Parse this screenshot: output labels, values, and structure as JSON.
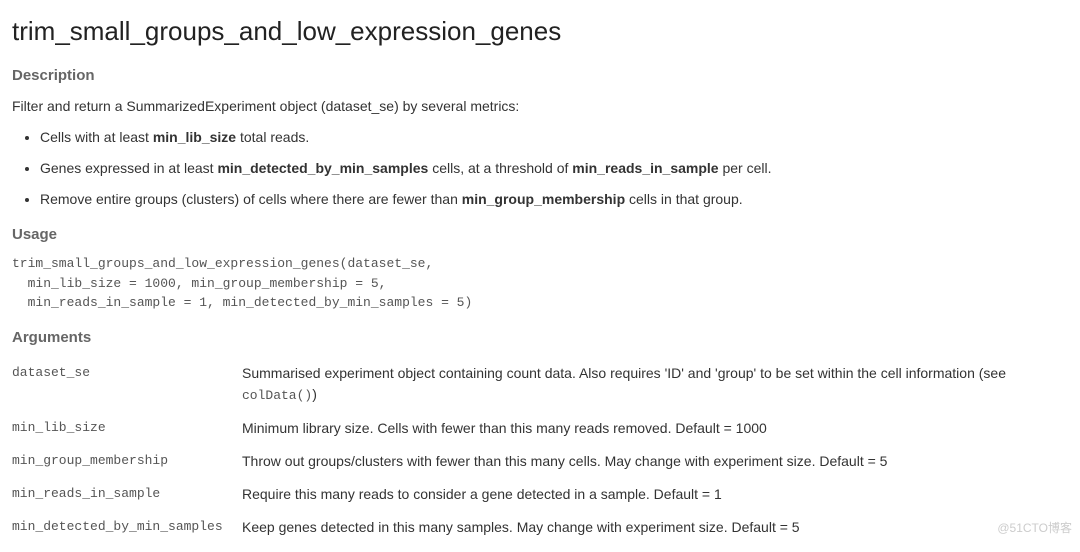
{
  "title": "trim_small_groups_and_low_expression_genes",
  "sections": {
    "description_heading": "Description",
    "usage_heading": "Usage",
    "arguments_heading": "Arguments"
  },
  "description": {
    "intro": "Filter and return a SummarizedExperiment object (dataset_se) by several metrics:",
    "bullets": [
      {
        "pre": "Cells with at least ",
        "b1": "min_lib_size",
        "post": " total reads."
      },
      {
        "pre": "Genes expressed in at least ",
        "b1": "min_detected_by_min_samples",
        "mid": " cells, at a threshold of ",
        "b2": "min_reads_in_sample",
        "post": " per cell."
      },
      {
        "pre": "Remove entire groups (clusters) of cells where there are fewer than ",
        "b1": "min_group_membership",
        "post": " cells in that group."
      }
    ]
  },
  "usage": "trim_small_groups_and_low_expression_genes(dataset_se,\n  min_lib_size = 1000, min_group_membership = 5,\n  min_reads_in_sample = 1, min_detected_by_min_samples = 5)",
  "arguments": [
    {
      "name": "dataset_se",
      "desc_pre": "Summarised experiment object containing count data. Also requires 'ID' and 'group' to be set within the cell information (see ",
      "mono": "colData()",
      "desc_post": ")"
    },
    {
      "name": "min_lib_size",
      "desc_pre": "Minimum library size. Cells with fewer than this many reads removed. Default = 1000",
      "mono": "",
      "desc_post": ""
    },
    {
      "name": "min_group_membership",
      "desc_pre": "Throw out groups/clusters with fewer than this many cells. May change with experiment size. Default = 5",
      "mono": "",
      "desc_post": ""
    },
    {
      "name": "min_reads_in_sample",
      "desc_pre": "Require this many reads to consider a gene detected in a sample. Default = 1",
      "mono": "",
      "desc_post": ""
    },
    {
      "name": "min_detected_by_min_samples",
      "desc_pre": "Keep genes detected in this many samples. May change with experiment size. Default = 5",
      "mono": "",
      "desc_post": ""
    }
  ],
  "watermark": "@51CTO博客"
}
